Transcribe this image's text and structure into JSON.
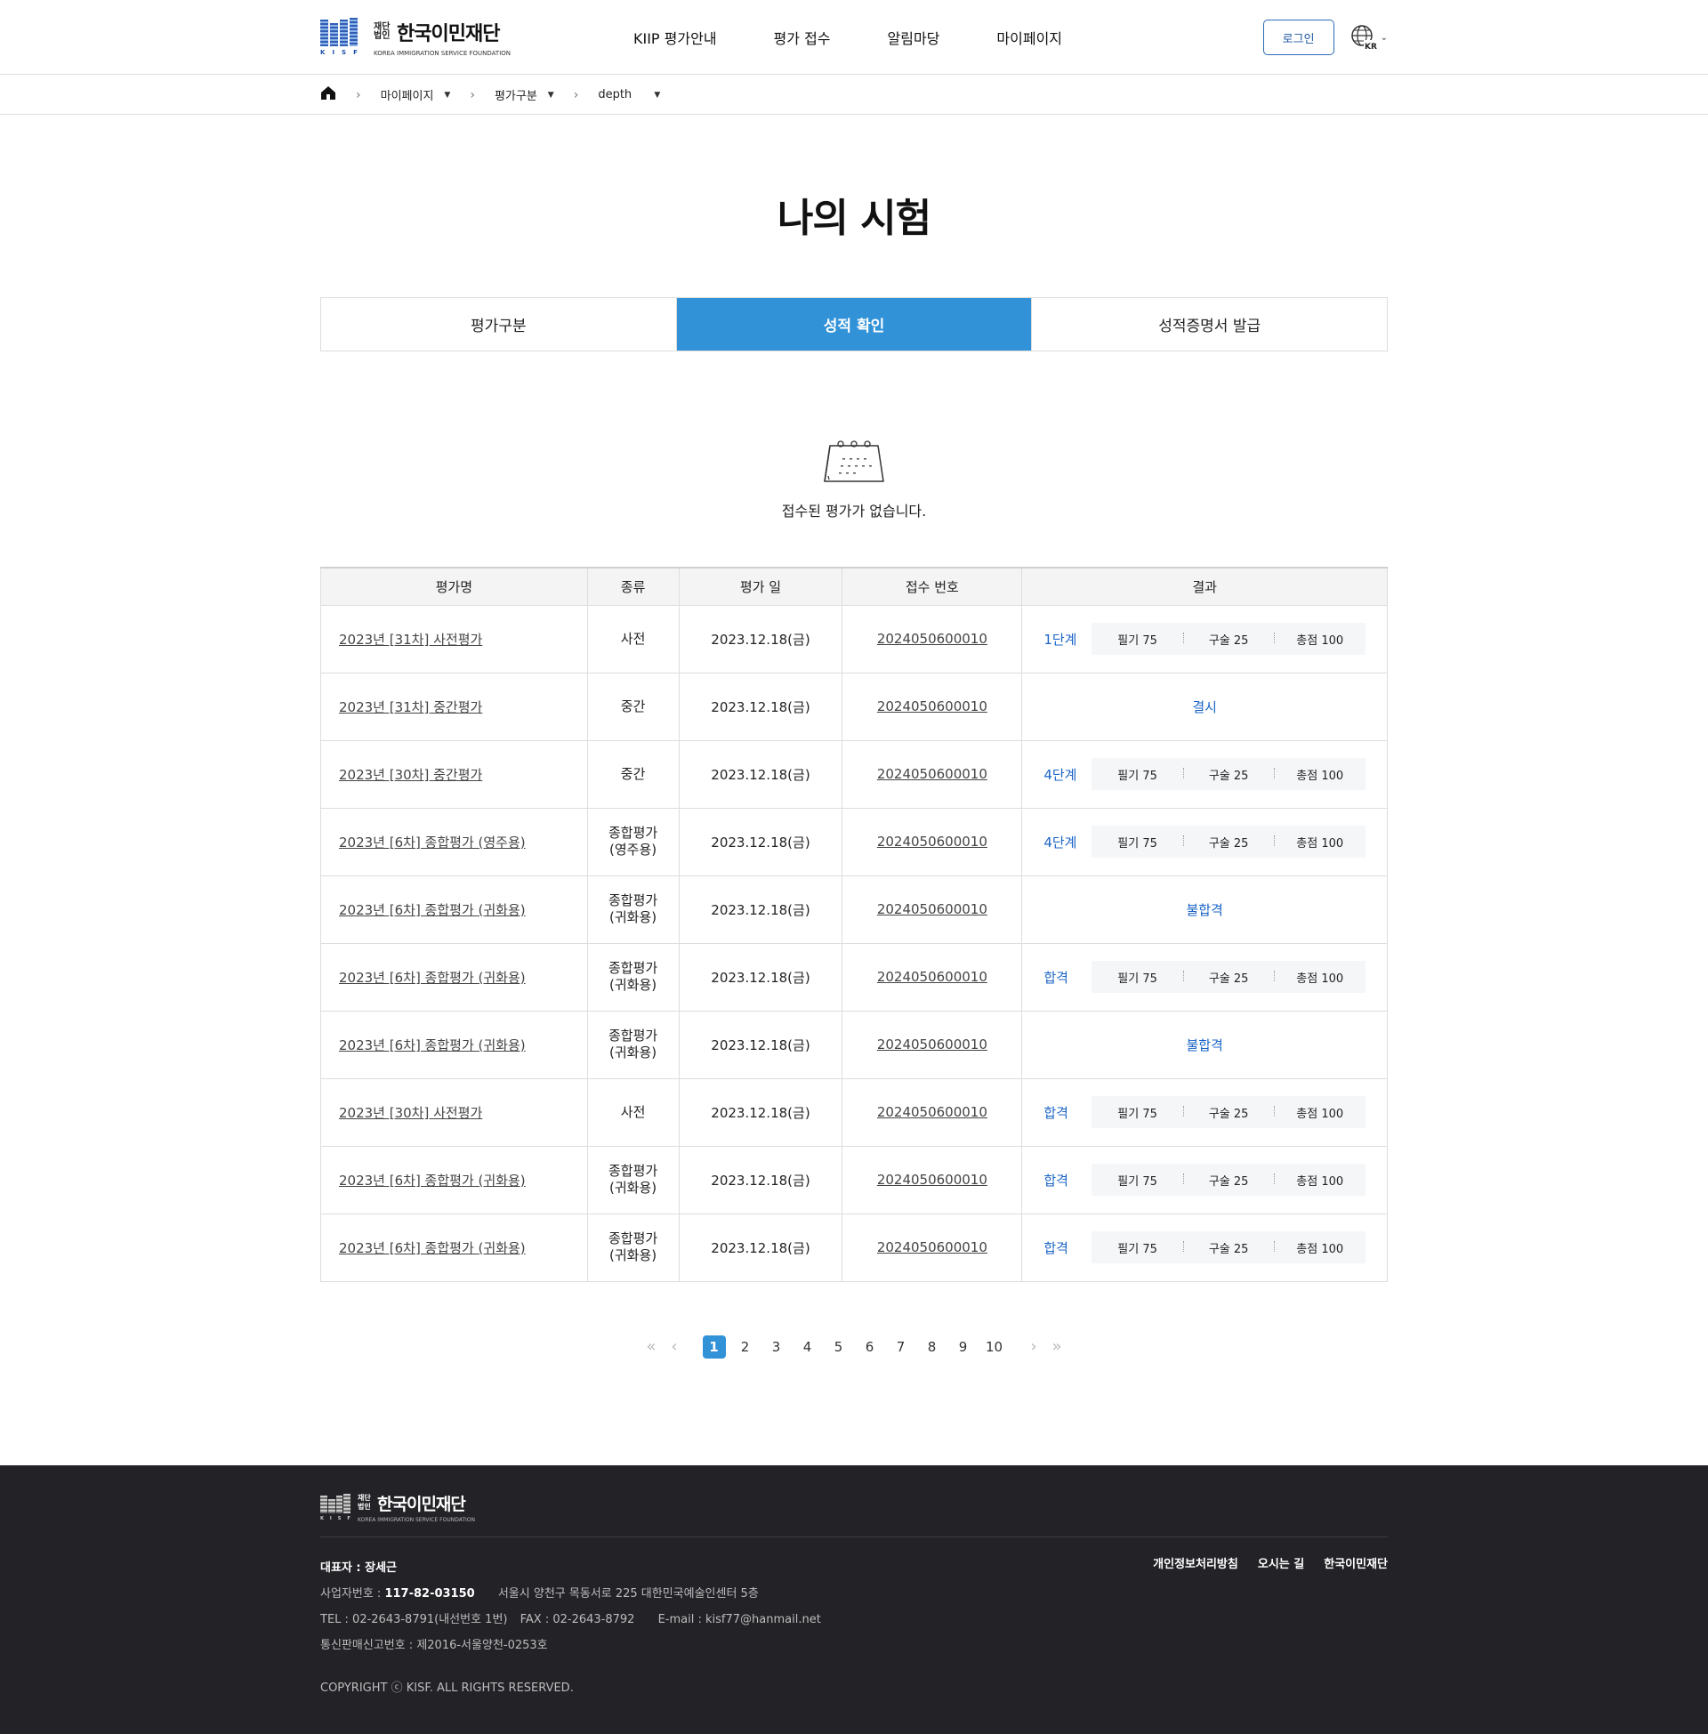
{
  "header": {
    "logo": {
      "small": "재단 법인",
      "name": "한국이민재단",
      "sub": "KOREA IMMIGRATION SERVICE FOUNDATION",
      "mark": "KISF"
    },
    "nav": [
      "KIIP 평가안내",
      "평가 접수",
      "알림마당",
      "마이페이지"
    ],
    "login_label": "로그인",
    "lang_label": "KR"
  },
  "breadcrumb": {
    "items": [
      "마이페이지",
      "평가구분",
      "depth"
    ]
  },
  "page_title": "나의 시험",
  "tabs": [
    {
      "label": "평가구분",
      "active": false
    },
    {
      "label": "성적 확인",
      "active": true
    },
    {
      "label": "성적증명서 발급",
      "active": false
    }
  ],
  "empty_state": {
    "icon": "calendar-icon",
    "message": "접수된 평가가 없습니다."
  },
  "table": {
    "headers": [
      "평가명",
      "종류",
      "평가 일",
      "접수 번호",
      "결과"
    ],
    "rows": [
      {
        "name": "2023년 [31차] 사전평가",
        "type_lines": [
          "사전"
        ],
        "date": "2023.12.18(금)",
        "receipt": "2024050600010",
        "result": "1단계",
        "scores": [
          "필기 75",
          "구술 25",
          "총점 100"
        ]
      },
      {
        "name": "2023년 [31차] 중간평가",
        "type_lines": [
          "중간"
        ],
        "date": "2023.12.18(금)",
        "receipt": "2024050600010",
        "result": "결시",
        "scores": null
      },
      {
        "name": "2023년 [30차] 중간평가",
        "type_lines": [
          "중간"
        ],
        "date": "2023.12.18(금)",
        "receipt": "2024050600010",
        "result": "4단계",
        "scores": [
          "필기 75",
          "구술 25",
          "총점 100"
        ]
      },
      {
        "name": "2023년 [6차] 종합평가 (영주용)",
        "type_lines": [
          "종합평가",
          "(영주용)"
        ],
        "date": "2023.12.18(금)",
        "receipt": "2024050600010",
        "result": "4단계",
        "scores": [
          "필기 75",
          "구술 25",
          "총점 100"
        ]
      },
      {
        "name": "2023년 [6차] 종합평가 (귀화용)",
        "type_lines": [
          "종합평가",
          "(귀화용)"
        ],
        "date": "2023.12.18(금)",
        "receipt": "2024050600010",
        "result": "불합격",
        "scores": null
      },
      {
        "name": "2023년 [6차] 종합평가 (귀화용)",
        "type_lines": [
          "종합평가",
          "(귀화용)"
        ],
        "date": "2023.12.18(금)",
        "receipt": "2024050600010",
        "result": "합격",
        "scores": [
          "필기 75",
          "구술 25",
          "총점 100"
        ]
      },
      {
        "name": "2023년 [6차] 종합평가 (귀화용)",
        "type_lines": [
          "종합평가",
          "(귀화용)"
        ],
        "date": "2023.12.18(금)",
        "receipt": "2024050600010",
        "result": "불합격",
        "scores": null
      },
      {
        "name": "2023년 [30차] 사전평가",
        "type_lines": [
          "사전"
        ],
        "date": "2023.12.18(금)",
        "receipt": "2024050600010",
        "result": "합격",
        "scores": [
          "필기 75",
          "구술 25",
          "총점 100"
        ]
      },
      {
        "name": "2023년 [6차] 종합평가 (귀화용)",
        "type_lines": [
          "종합평가",
          "(귀화용)"
        ],
        "date": "2023.12.18(금)",
        "receipt": "2024050600010",
        "result": "합격",
        "scores": [
          "필기 75",
          "구술 25",
          "총점 100"
        ]
      },
      {
        "name": "2023년 [6차] 종합평가 (귀화용)",
        "type_lines": [
          "종합평가",
          "(귀화용)"
        ],
        "date": "2023.12.18(금)",
        "receipt": "2024050600010",
        "result": "합격",
        "scores": [
          "필기 75",
          "구술 25",
          "총점 100"
        ]
      }
    ]
  },
  "pagination": {
    "pages": [
      "1",
      "2",
      "3",
      "4",
      "5",
      "6",
      "7",
      "8",
      "9",
      "10"
    ],
    "current": "1",
    "first": "«",
    "prev": "‹",
    "next": "›",
    "last": "»"
  },
  "footer": {
    "links": [
      "개인정보처리방침",
      "오시는 길",
      "한국이민재단"
    ],
    "representative": "대표자 : 장세근",
    "biz_label": "사업자번호 : ",
    "biz_number": "117-82-03150",
    "address": "서울시 양천구 목동서로 225 대한민국예술인센터 5층",
    "tel": "TEL : 02-2643-8791(내선번호 1번)",
    "fax": "FAX : 02-2643-8792",
    "email": "E-mail : kisf77@hanmail.net",
    "mail_order": "통신판매신고번호 : 제2016-서울양천-0253호",
    "copyright": "COPYRIGHT ⓒ KISF. ALL RIGHTS RESERVED."
  },
  "colors": {
    "accent": "#3192d8",
    "result_text": "#1b64c6",
    "footer_bg": "#222227"
  }
}
